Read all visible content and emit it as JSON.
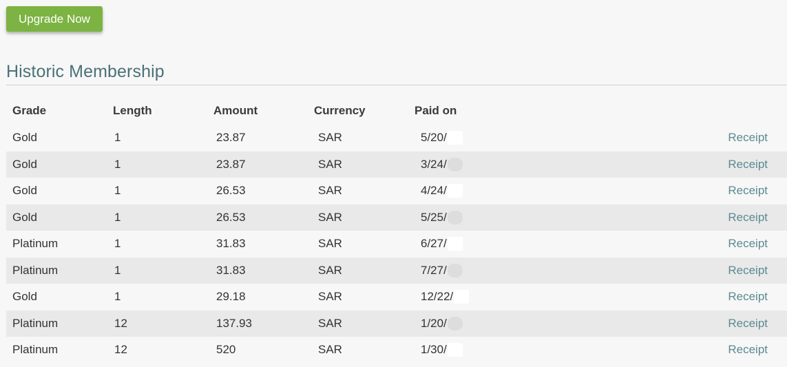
{
  "actions": {
    "upgrade_label": "Upgrade Now",
    "button_color": "#7cb342"
  },
  "section": {
    "title": "Historic Membership",
    "title_color": "#4a7178"
  },
  "table": {
    "columns": {
      "grade": "Grade",
      "length": "Length",
      "amount": "Amount",
      "currency": "Currency",
      "paid_on": "Paid on"
    },
    "rows": [
      {
        "grade": "Gold",
        "length": "1",
        "amount": "23.87",
        "currency": "SAR",
        "paid_on": "5/20/",
        "receipt": "Receipt"
      },
      {
        "grade": "Gold",
        "length": "1",
        "amount": "23.87",
        "currency": "SAR",
        "paid_on": "3/24/",
        "receipt": "Receipt"
      },
      {
        "grade": "Gold",
        "length": "1",
        "amount": "26.53",
        "currency": "SAR",
        "paid_on": "4/24/",
        "receipt": "Receipt"
      },
      {
        "grade": "Gold",
        "length": "1",
        "amount": "26.53",
        "currency": "SAR",
        "paid_on": "5/25/",
        "receipt": "Receipt"
      },
      {
        "grade": "Platinum",
        "length": "1",
        "amount": "31.83",
        "currency": "SAR",
        "paid_on": "6/27/",
        "receipt": "Receipt"
      },
      {
        "grade": "Platinum",
        "length": "1",
        "amount": "31.83",
        "currency": "SAR",
        "paid_on": "7/27/",
        "receipt": "Receipt"
      },
      {
        "grade": "Gold",
        "length": "1",
        "amount": "29.18",
        "currency": "SAR",
        "paid_on": "12/22/",
        "receipt": "Receipt"
      },
      {
        "grade": "Platinum",
        "length": "12",
        "amount": "137.93",
        "currency": "SAR",
        "paid_on": "1/20/",
        "receipt": "Receipt"
      },
      {
        "grade": "Platinum",
        "length": "12",
        "amount": "520",
        "currency": "SAR",
        "paid_on": "1/30/",
        "receipt": "Receipt"
      }
    ],
    "link_color": "#5b8a91",
    "stripe_color": "#e9e9e9"
  }
}
